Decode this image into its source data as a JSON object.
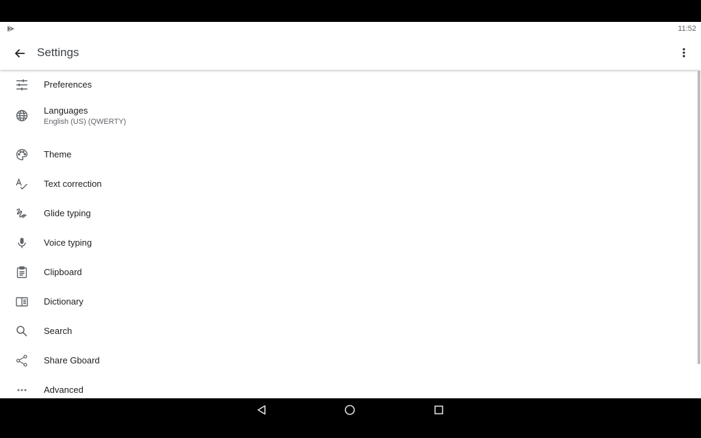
{
  "status_bar": {
    "notification_icon": "play-store-icon",
    "time": "11:52"
  },
  "app_bar": {
    "back_icon": "arrow-back-icon",
    "title": "Settings",
    "more_icon": "more-vert-icon"
  },
  "settings": {
    "items": [
      {
        "icon": "tune-icon",
        "label": "Preferences"
      },
      {
        "icon": "globe-icon",
        "label": "Languages",
        "subtitle": "English (US) (QWERTY)"
      },
      {
        "icon": "palette-icon",
        "label": "Theme"
      },
      {
        "icon": "spellcheck-icon",
        "label": "Text correction"
      },
      {
        "icon": "gesture-icon",
        "label": "Glide typing"
      },
      {
        "icon": "mic-icon",
        "label": "Voice typing"
      },
      {
        "icon": "clipboard-icon",
        "label": "Clipboard"
      },
      {
        "icon": "dictionary-icon",
        "label": "Dictionary"
      },
      {
        "icon": "search-icon",
        "label": "Search"
      },
      {
        "icon": "share-icon",
        "label": "Share Gboard"
      },
      {
        "icon": "more-horiz-icon",
        "label": "Advanced"
      }
    ]
  },
  "nav_bar": {
    "back": "nav-back-icon",
    "home": "nav-home-icon",
    "recents": "nav-recents-icon"
  },
  "colors": {
    "icon": "#5f6368",
    "text_primary": "#202124",
    "text_secondary": "#5f6368",
    "background": "#ffffff"
  }
}
